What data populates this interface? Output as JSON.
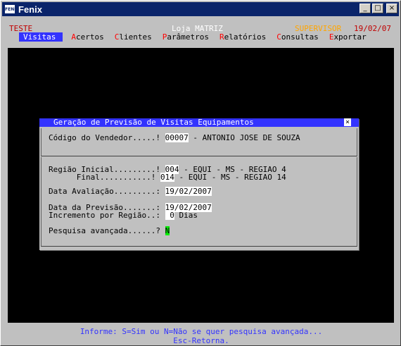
{
  "window": {
    "title": "Fenix",
    "icon_label": "FENIX"
  },
  "header": {
    "system": "TESTE",
    "store": "Loja MATRIZ",
    "user": "SUPERVISOR",
    "date": "19/02/07"
  },
  "menu": [
    {
      "hot": "V",
      "rest": "isitas",
      "active": true
    },
    {
      "hot": "A",
      "rest": "certos",
      "active": false
    },
    {
      "hot": "C",
      "rest": "lientes",
      "active": false
    },
    {
      "hot": "P",
      "rest": "arâmetros",
      "active": false
    },
    {
      "hot": "R",
      "rest": "elatórios",
      "active": false
    },
    {
      "hot": "C",
      "rest": "onsultas",
      "active": false
    },
    {
      "hot": "E",
      "rest": "xportar",
      "active": false
    }
  ],
  "dialog": {
    "title": "Geração de Previsão de Visitas Equipamentos",
    "close": "×",
    "vendedor": {
      "label": "Código do Vendedor.....!",
      "code": "00007",
      "name": " - ANTONIO JOSE DE SOUZA"
    },
    "regiao_inicial": {
      "label": "Região Inicial.........!",
      "code": "004",
      "desc": " - EQUI - MS - REGIAO 4"
    },
    "regiao_final": {
      "label": "      Final...........!",
      "code": "014",
      "desc": " - EQUI - MS - REGIAO 14"
    },
    "data_avaliacao": {
      "label": "Data Avaliação.........:",
      "value": "19/02/2007"
    },
    "data_previsao": {
      "label": "Data da Previsão.......:",
      "value": "19/02/2007"
    },
    "incremento": {
      "label": "Incremento por Região..:",
      "value": " 0",
      "unit": " Dias"
    },
    "pesquisa": {
      "label": "Pesquisa avançada......?",
      "value": "N"
    }
  },
  "footer": {
    "info": "Informe: S=Sim ou N=Não se quer pesquisa avançada...",
    "esc": "Esc-Retorna."
  }
}
